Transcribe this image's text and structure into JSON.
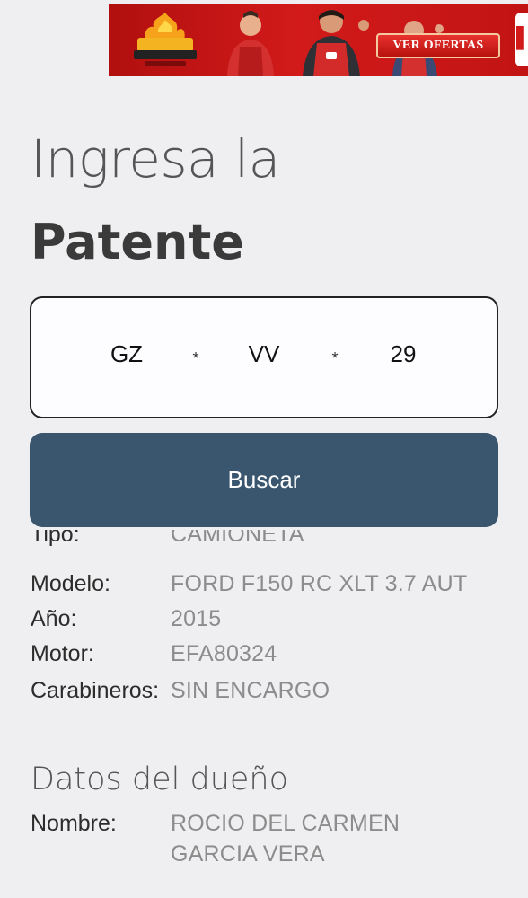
{
  "ad": {
    "cta_label": "VER OFERTAS",
    "logo_icon": "cyber-fire-logo-icon",
    "colors": {
      "background": "#c81616",
      "cta": "#d42420"
    }
  },
  "heading": {
    "line1": "Ingresa la",
    "line2": "Patente"
  },
  "plate": {
    "part1": "GZ",
    "sep1": "*",
    "part2": "VV",
    "sep2": "*",
    "part3": "29"
  },
  "search_button": {
    "label": "Buscar",
    "color": "#3a566f"
  },
  "vehicle": {
    "tipo_label": "Tipo:",
    "tipo_value": "CAMIONETA",
    "modelo_label": "Modelo:",
    "modelo_value": "FORD F150 RC XLT 3.7 AUT",
    "anio_label": "Año:",
    "anio_value": "2015",
    "motor_label": "Motor:",
    "motor_value": "EFA80324",
    "carab_label": "Carabineros:",
    "carab_value": "SIN ENCARGO"
  },
  "owner": {
    "section_title": "Datos del dueño",
    "nombre_label": "Nombre:",
    "nombre_line1": "ROCIO DEL CARMEN",
    "nombre_line2": "GARCIA VERA"
  }
}
